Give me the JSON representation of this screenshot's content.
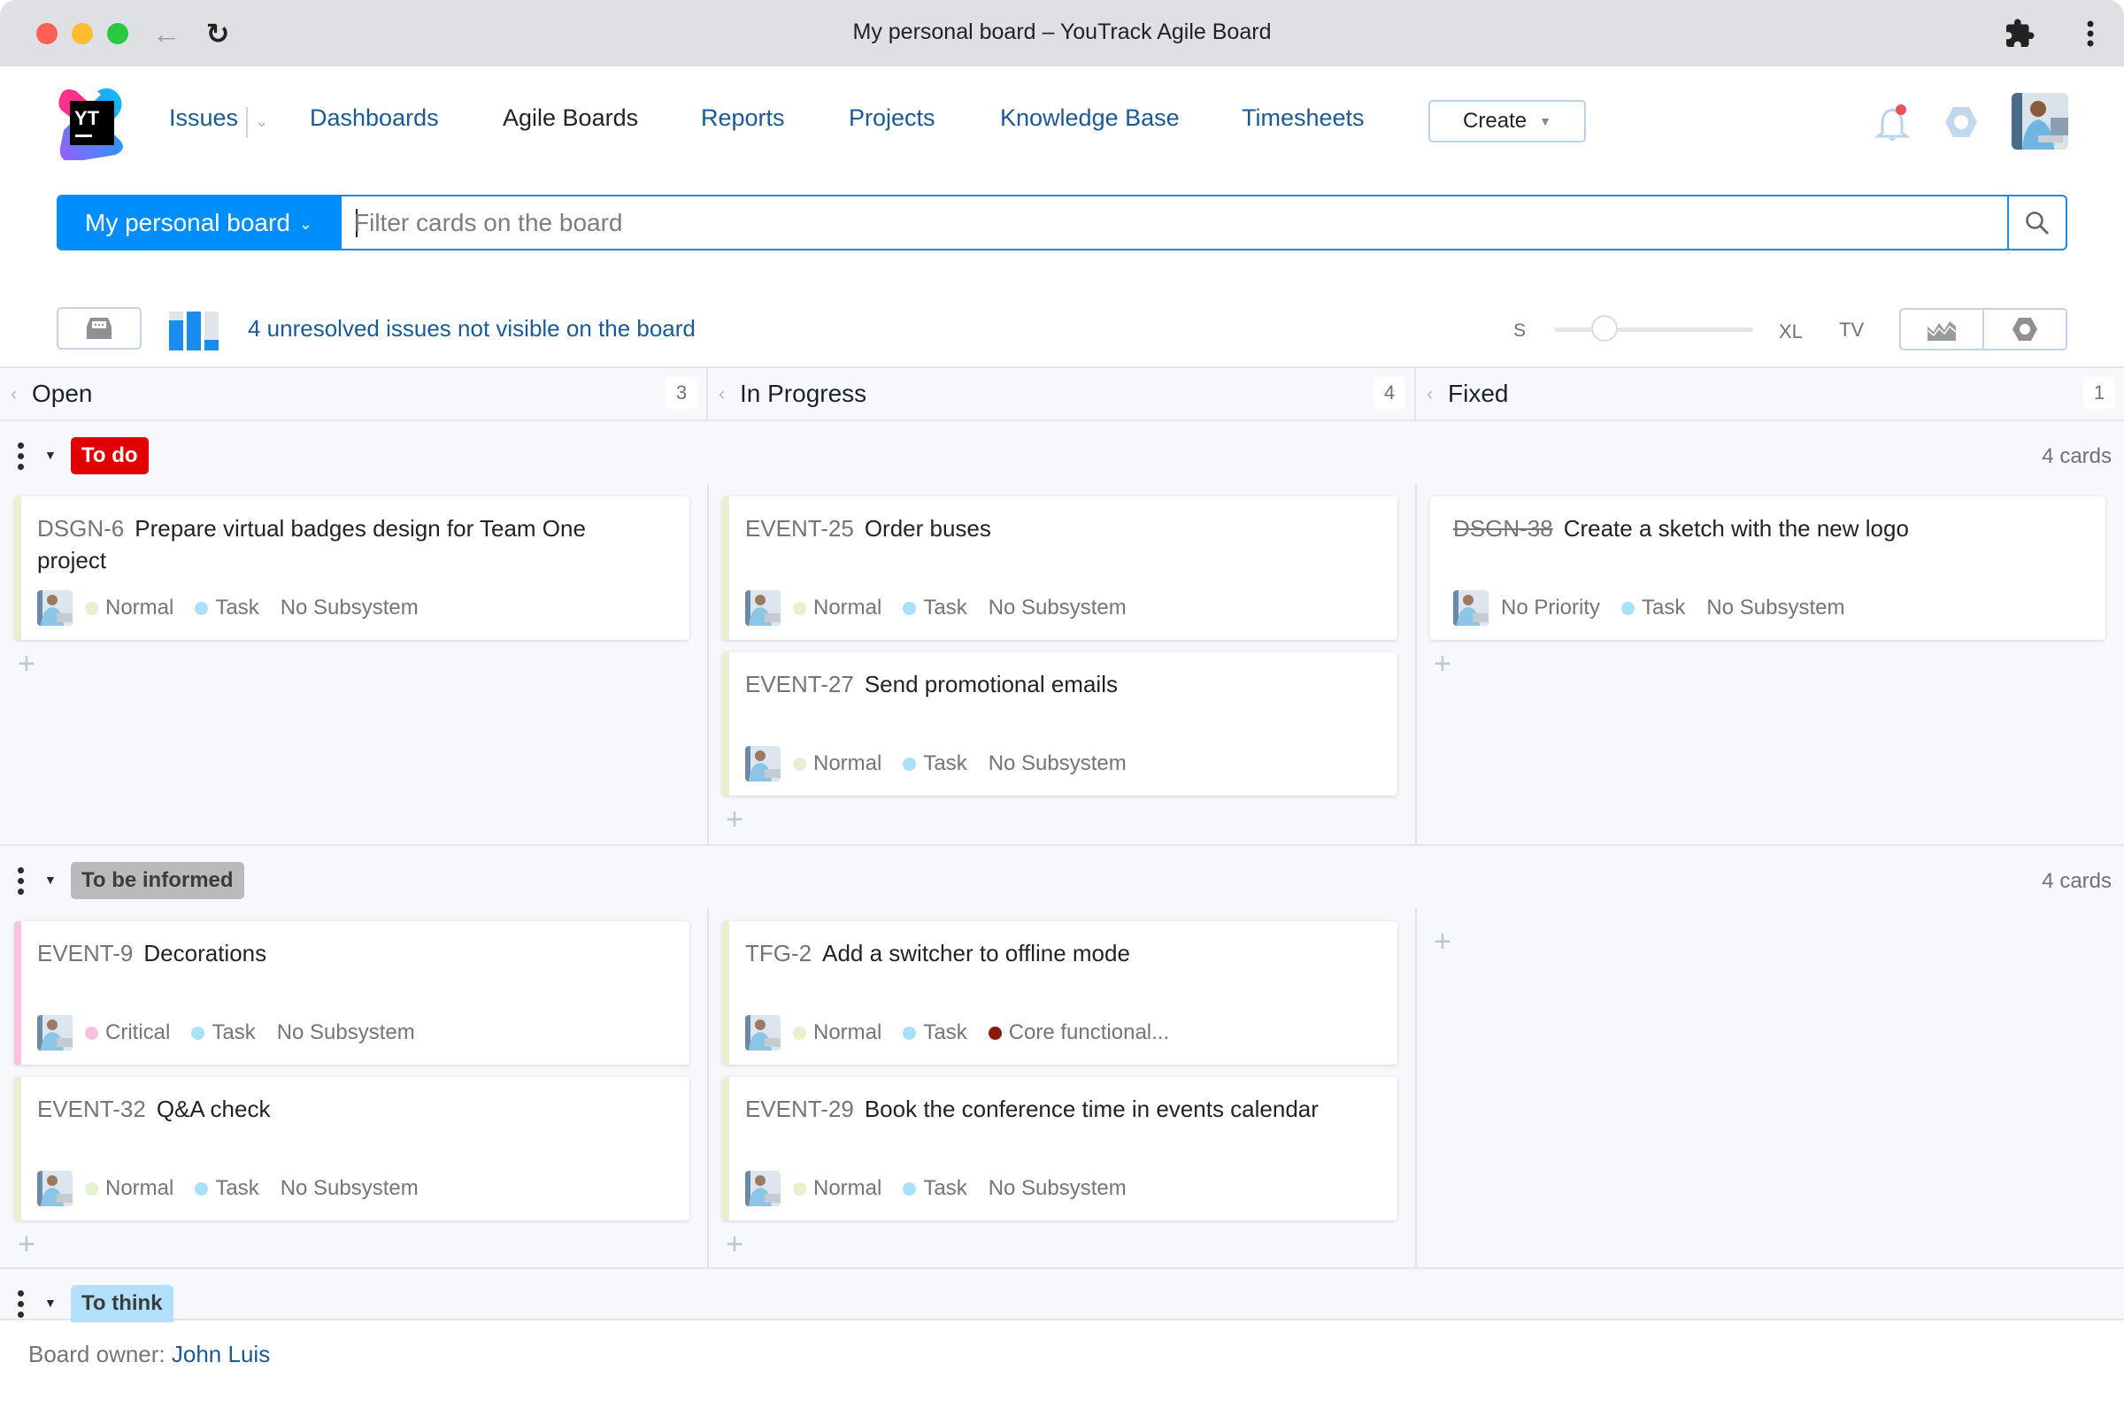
{
  "browser": {
    "title": "My personal board – YouTrack Agile Board",
    "back_icon": "arrow-left-icon",
    "reload_icon": "reload-icon",
    "extensions_icon": "puzzle-piece-icon",
    "menu_icon": "vertical-dots-icon"
  },
  "header": {
    "logo_text": "YT",
    "nav": [
      {
        "label": "Issues",
        "active": false
      },
      {
        "label": "Dashboards",
        "active": false
      },
      {
        "label": "Agile Boards",
        "active": true
      },
      {
        "label": "Reports",
        "active": false
      },
      {
        "label": "Projects",
        "active": false
      },
      {
        "label": "Knowledge Base",
        "active": false
      },
      {
        "label": "Timesheets",
        "active": false
      }
    ],
    "create_label": "Create",
    "notification_badge_color": "#e8505b"
  },
  "search": {
    "board_name": "My personal board",
    "placeholder": "Filter cards on the board",
    "value": ""
  },
  "toolbar": {
    "unresolved_text": "4 unresolved issues not visible on the board",
    "size_labels": {
      "small": "S",
      "large": "XL",
      "tv": "TV"
    },
    "card_size_level": 0.25
  },
  "columns": [
    {
      "title": "Open",
      "count": "3"
    },
    {
      "title": "In Progress",
      "count": "4"
    },
    {
      "title": "Fixed",
      "count": "1"
    }
  ],
  "swimlanes": [
    {
      "name": "To do",
      "style": "red",
      "count_label": "4 cards",
      "cells": [
        [
          {
            "id": "DSGN-6",
            "title": "Prepare virtual badges design for Team One project",
            "priority": "Normal",
            "priority_color": "#e6f2cf",
            "type": "Task",
            "type_color": "#a9e0fb",
            "subsystem": "No Subsystem",
            "subsystem_color": "",
            "resolved": false
          }
        ],
        [
          {
            "id": "EVENT-25",
            "title": "Order buses",
            "priority": "Normal",
            "priority_color": "#e6f2cf",
            "type": "Task",
            "type_color": "#a9e0fb",
            "subsystem": "No Subsystem",
            "subsystem_color": "",
            "resolved": false
          },
          {
            "id": "EVENT-27",
            "title": "Send promotional emails",
            "priority": "Normal",
            "priority_color": "#e6f2cf",
            "type": "Task",
            "type_color": "#a9e0fb",
            "subsystem": "No Subsystem",
            "subsystem_color": "",
            "resolved": false
          }
        ],
        [
          {
            "id": "DSGN-38",
            "title": "Create a sketch with the new logo",
            "priority": "No Priority",
            "priority_color": "",
            "type": "Task",
            "type_color": "#a9e0fb",
            "subsystem": "No Subsystem",
            "subsystem_color": "",
            "resolved": true
          }
        ]
      ]
    },
    {
      "name": "To be informed",
      "style": "gray",
      "count_label": "4 cards",
      "cells": [
        [
          {
            "id": "EVENT-9",
            "title": "Decorations",
            "priority": "Critical",
            "priority_color": "#fbc2dd",
            "type": "Task",
            "type_color": "#a9e0fb",
            "subsystem": "No Subsystem",
            "subsystem_color": "",
            "resolved": false
          },
          {
            "id": "EVENT-32",
            "title": "Q&A check",
            "priority": "Normal",
            "priority_color": "#e6f2cf",
            "type": "Task",
            "type_color": "#a9e0fb",
            "subsystem": "No Subsystem",
            "subsystem_color": "",
            "resolved": false
          }
        ],
        [
          {
            "id": "TFG-2",
            "title": "Add a switcher to offline mode",
            "priority": "Normal",
            "priority_color": "#e6f2cf",
            "type": "Task",
            "type_color": "#a9e0fb",
            "subsystem": "Core functional...",
            "subsystem_color": "#8c1a0a",
            "resolved": false
          },
          {
            "id": "EVENT-29",
            "title": "Book the conference time in events calendar",
            "priority": "Normal",
            "priority_color": "#e6f2cf",
            "type": "Task",
            "type_color": "#a9e0fb",
            "subsystem": "No Subsystem",
            "subsystem_color": "",
            "resolved": false
          }
        ],
        []
      ]
    },
    {
      "name": "To think",
      "style": "blue",
      "count_label": "",
      "cells": [
        [],
        [],
        []
      ]
    }
  ],
  "footer": {
    "owner_label": "Board owner:",
    "owner_name": "John Luis"
  },
  "colors": {
    "accent": "#008eff",
    "link": "#1a5a96",
    "todo_tag": "#e30000",
    "informed_tag": "#b9babc",
    "think_tag": "#b3e0fb"
  }
}
